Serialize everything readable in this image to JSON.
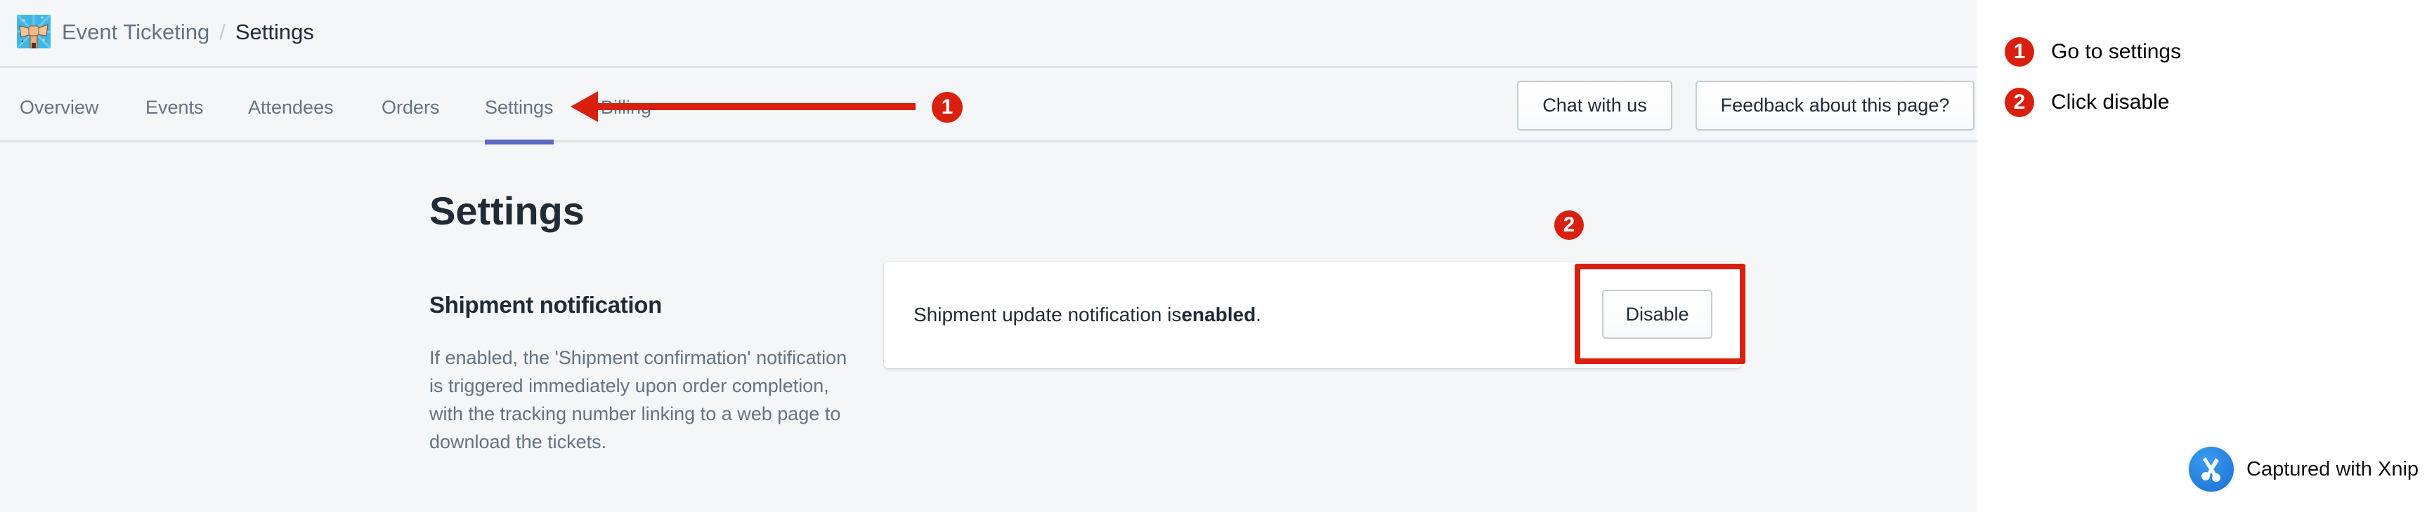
{
  "header": {
    "app_name": "Event Ticketing",
    "separator": "/",
    "current_page": "Settings",
    "logo_icon": "ticket-fist-logo"
  },
  "nav": {
    "tabs": [
      {
        "label": "Overview",
        "active": false
      },
      {
        "label": "Events",
        "active": false
      },
      {
        "label": "Attendees",
        "active": false
      },
      {
        "label": "Orders",
        "active": false
      },
      {
        "label": "Settings",
        "active": true
      },
      {
        "label": "Billing",
        "active": false
      }
    ],
    "chat_button": "Chat with us",
    "feedback_button": "Feedback about this page?"
  },
  "main": {
    "page_title": "Settings",
    "section": {
      "title": "Shipment notification",
      "description": "If enabled, the 'Shipment confirmation' notification is triggered immediately upon order completion, with the tracking number linking to a web page to download the tickets.",
      "status_prefix": "Shipment update notification is ",
      "status_value": "enabled",
      "status_suffix": ".",
      "action_button": "Disable"
    }
  },
  "annotations": {
    "color": "#d9200f",
    "markers": [
      {
        "number": "1",
        "target": "Settings tab"
      },
      {
        "number": "2",
        "target": "Disable button"
      }
    ]
  },
  "steps": [
    {
      "number": "1",
      "text": "Go to settings"
    },
    {
      "number": "2",
      "text": "Click disable"
    }
  ],
  "watermark": {
    "text": "Captured with Xnip",
    "icon": "scissors-icon"
  },
  "colors": {
    "accent": "#5c6ac4",
    "background": "#f4f6f8",
    "text_primary": "#212b36",
    "text_secondary": "#637381",
    "annotation_red": "#d9200f"
  }
}
